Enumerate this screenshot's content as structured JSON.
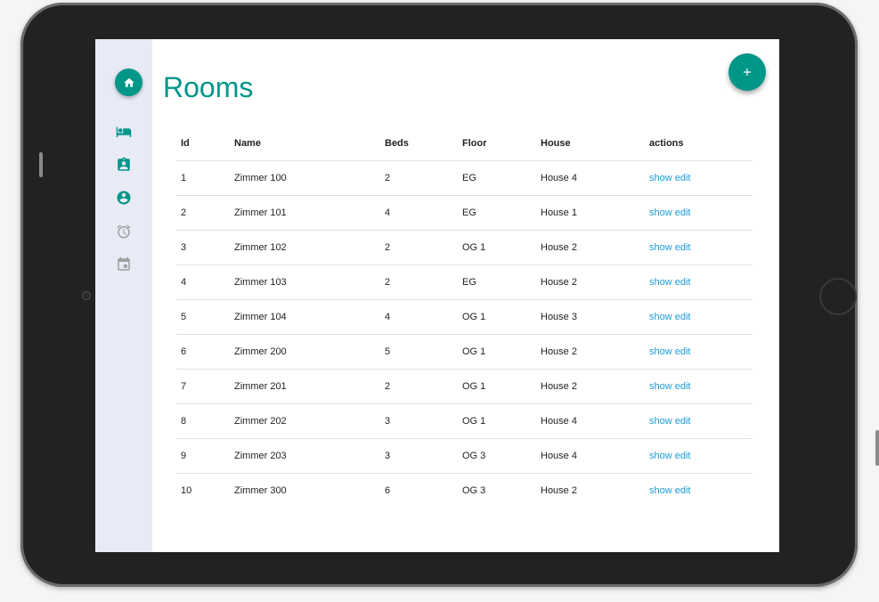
{
  "page": {
    "title": "Rooms"
  },
  "sidebar": {
    "items": [
      {
        "icon": "bed-icon",
        "color": "#009688"
      },
      {
        "icon": "badge-icon",
        "color": "#009688"
      },
      {
        "icon": "account-circle-icon",
        "color": "#009688"
      },
      {
        "icon": "alarm-icon",
        "color": "#9e9e9e"
      },
      {
        "icon": "calendar-icon",
        "color": "#9e9e9e"
      }
    ]
  },
  "table": {
    "headers": {
      "id": "Id",
      "name": "Name",
      "beds": "Beds",
      "floor": "Floor",
      "house": "House",
      "actions": "actions"
    },
    "rows": [
      {
        "id": "1",
        "name": "Zimmer 100",
        "beds": "2",
        "floor": "EG",
        "house": "House 4",
        "show": "show",
        "edit": "edit"
      },
      {
        "id": "2",
        "name": "Zimmer 101",
        "beds": "4",
        "floor": "EG",
        "house": "House 1",
        "show": "show",
        "edit": "edit"
      },
      {
        "id": "3",
        "name": "Zimmer 102",
        "beds": "2",
        "floor": "OG 1",
        "house": "House 2",
        "show": "show",
        "edit": "edit"
      },
      {
        "id": "4",
        "name": "Zimmer 103",
        "beds": "2",
        "floor": "EG",
        "house": "House 2",
        "show": "show",
        "edit": "edit"
      },
      {
        "id": "5",
        "name": "Zimmer 104",
        "beds": "4",
        "floor": "OG 1",
        "house": "House 3",
        "show": "show",
        "edit": "edit"
      },
      {
        "id": "6",
        "name": "Zimmer 200",
        "beds": "5",
        "floor": "OG 1",
        "house": "House 2",
        "show": "show",
        "edit": "edit"
      },
      {
        "id": "7",
        "name": "Zimmer 201",
        "beds": "2",
        "floor": "OG 1",
        "house": "House 2",
        "show": "show",
        "edit": "edit"
      },
      {
        "id": "8",
        "name": "Zimmer 202",
        "beds": "3",
        "floor": "OG 1",
        "house": "House 4",
        "show": "show",
        "edit": "edit"
      },
      {
        "id": "9",
        "name": "Zimmer 203",
        "beds": "3",
        "floor": "OG 3",
        "house": "House 4",
        "show": "show",
        "edit": "edit"
      },
      {
        "id": "10",
        "name": "Zimmer 300",
        "beds": "6",
        "floor": "OG 3",
        "house": "House 2",
        "show": "show",
        "edit": "edit"
      }
    ]
  },
  "colors": {
    "accent": "#009688",
    "link": "#1a9cd8",
    "sidebar_bg": "#e8eaf6"
  }
}
